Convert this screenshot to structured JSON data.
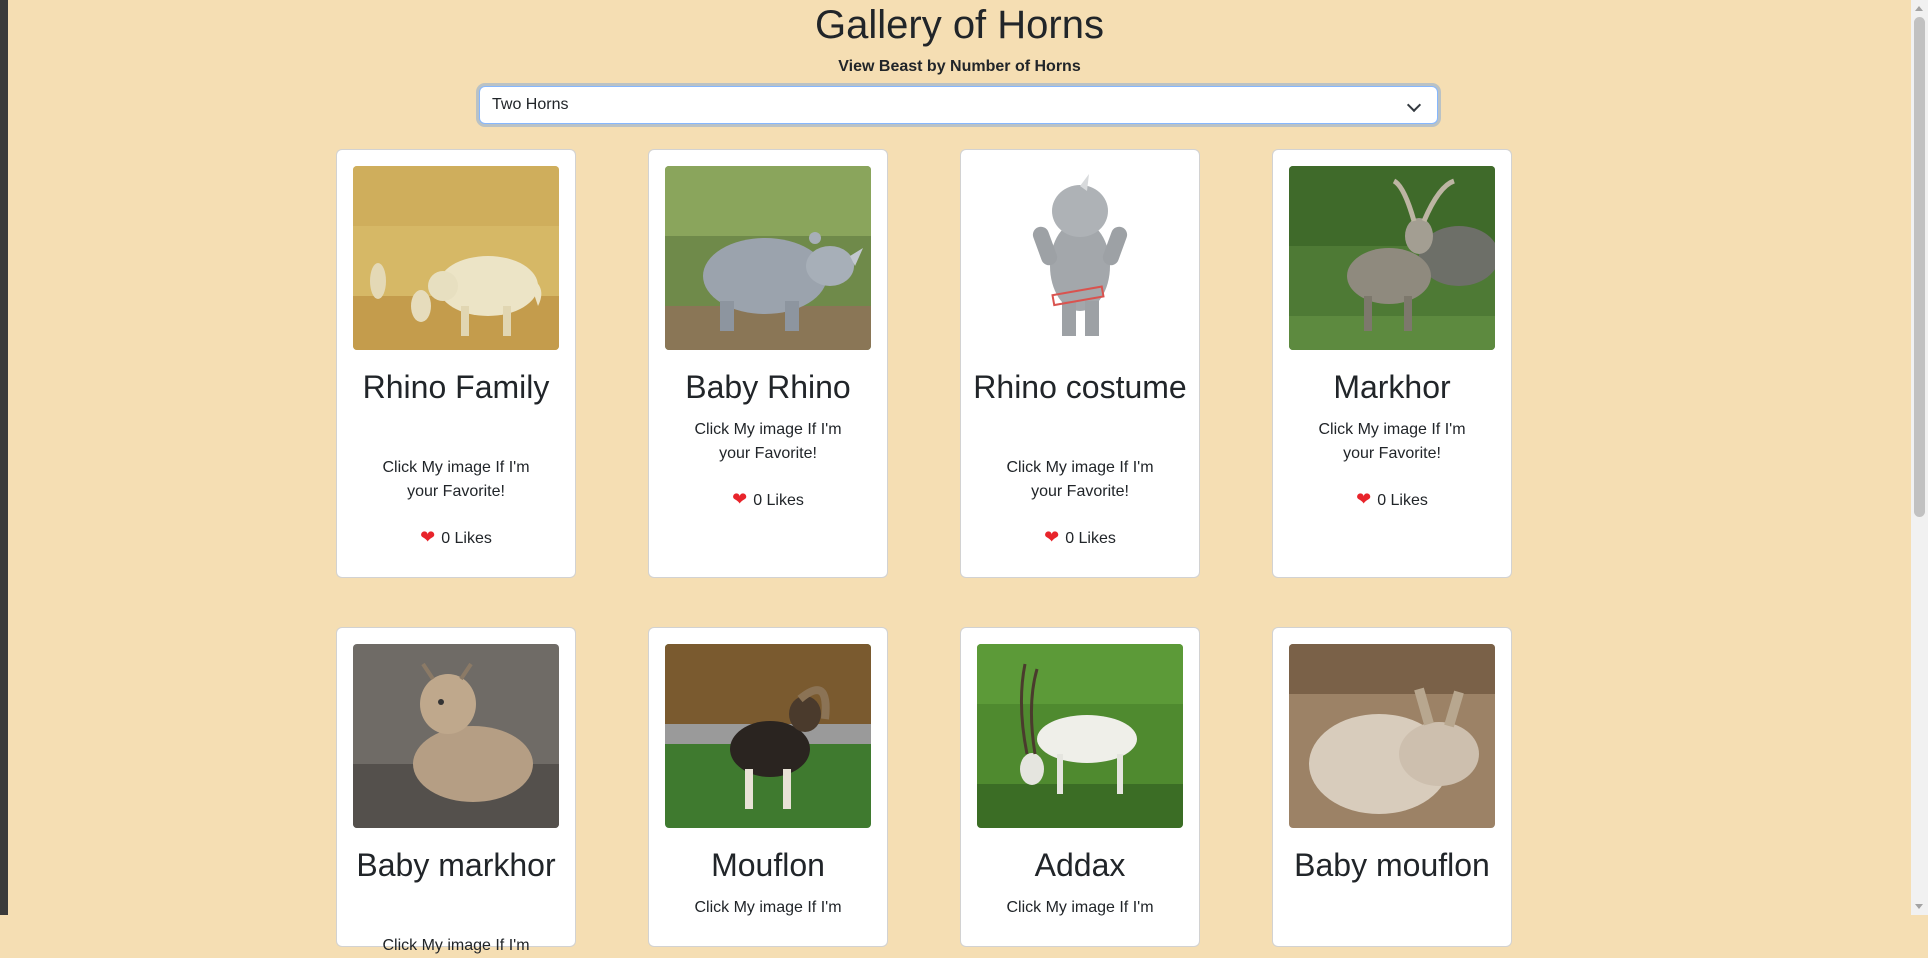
{
  "header": {
    "title": "Gallery of Horns",
    "subtitle": "View Beast by Number of Horns"
  },
  "filter": {
    "selected": "Two Horns"
  },
  "cards": [
    {
      "name": "Rhino Family",
      "desc": "Click My image If I'm your Favorite!",
      "likes": "0 Likes",
      "image": "rhino-family-photo"
    },
    {
      "name": "Baby Rhino",
      "desc": "Click My image If I'm your Favorite!",
      "likes": "0 Likes",
      "image": "baby-rhino-photo"
    },
    {
      "name": "Rhino costume",
      "desc": "Click My image If I'm your Favorite!",
      "likes": "0 Likes",
      "image": "rhino-costume-photo"
    },
    {
      "name": "Markhor",
      "desc": "Click My image If I'm your Favorite!",
      "likes": "0 Likes",
      "image": "markhor-photo"
    },
    {
      "name": "Baby markhor",
      "desc": "Click My image If I'm",
      "image": "baby-markhor-photo"
    },
    {
      "name": "Mouflon",
      "desc": "Click My image If I'm",
      "image": "mouflon-photo"
    },
    {
      "name": "Addax",
      "desc": "Click My image If I'm",
      "image": "addax-photo"
    },
    {
      "name": "Baby mouflon",
      "desc": "",
      "image": "baby-mouflon-photo"
    }
  ],
  "icons": {
    "heart": "heart-icon",
    "dropdown": "chevron-down-icon"
  },
  "colors": {
    "background": "#f5deb3",
    "heart": "#e8242b",
    "focus_border": "#86b7fe"
  }
}
